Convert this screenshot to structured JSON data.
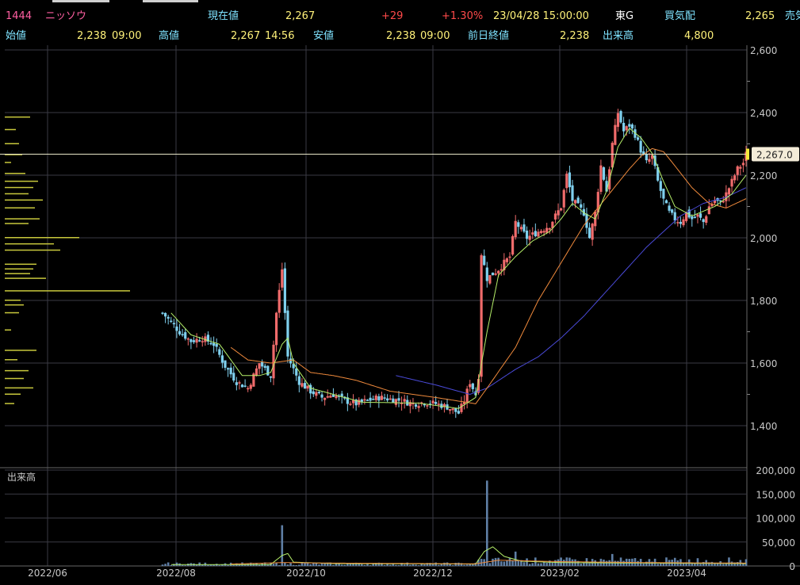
{
  "header": {
    "code": "1444",
    "name": "ニッソウ",
    "current_label": "現在値",
    "current_value": "2,267",
    "change": "+29",
    "change_pct": "+1.30%",
    "datetime": "23/04/28  15:00:00",
    "market": "東G",
    "bid_label": "買気配",
    "bid_value": "2,265",
    "ask_label": "売気"
  },
  "subheader": {
    "open_label": "始値",
    "open_value": "2,238",
    "open_time": "09:00",
    "high_label": "高値",
    "high_value": "2,267",
    "high_time": "14:56",
    "low_label": "安値",
    "low_value": "2,238",
    "low_time": "09:00",
    "prev_label": "前日終値",
    "prev_value": "2,238",
    "volume_label": "出来高",
    "volume_value": "4,800"
  },
  "colors": {
    "up": "#f06b6b",
    "down": "#7fd0ee",
    "ma_short": "#b6f06a",
    "ma_mid": "#f08a3c",
    "ma_long": "#4a4ad8",
    "grid": "#3a3a44",
    "volume": "#5f7fa5",
    "price_profile": "#c8c83c"
  },
  "chart_data": {
    "type": "candlestick",
    "y_axis": {
      "min": 1400,
      "max": 2600,
      "ticks": [
        "2,600",
        "2,400",
        "2,200",
        "2,000",
        "1,800",
        "1,600",
        "1,400"
      ],
      "tick_values": [
        2600,
        2400,
        2200,
        2000,
        1800,
        1600,
        1400
      ]
    },
    "x_axis": {
      "ticks": [
        "2022/06",
        "2022/08",
        "2022/10",
        "2022/12",
        "2023/02",
        "2023/04"
      ]
    },
    "current_price": 2267,
    "current_price_label": "2,267.0",
    "close_anchors": [
      [
        0,
        1760
      ],
      [
        6,
        1700
      ],
      [
        10,
        1670
      ],
      [
        14,
        1680
      ],
      [
        18,
        1660
      ],
      [
        22,
        1590
      ],
      [
        26,
        1540
      ],
      [
        30,
        1520
      ],
      [
        34,
        1600
      ],
      [
        38,
        1560
      ],
      [
        40,
        1760
      ],
      [
        42,
        1900
      ],
      [
        44,
        1620
      ],
      [
        48,
        1540
      ],
      [
        52,
        1510
      ],
      [
        56,
        1490
      ],
      [
        60,
        1500
      ],
      [
        64,
        1480
      ],
      [
        68,
        1470
      ],
      [
        72,
        1480
      ],
      [
        76,
        1490
      ],
      [
        80,
        1485
      ],
      [
        84,
        1480
      ],
      [
        88,
        1470
      ],
      [
        92,
        1475
      ],
      [
        96,
        1470
      ],
      [
        100,
        1460
      ],
      [
        104,
        1440
      ],
      [
        106,
        1480
      ],
      [
        108,
        1540
      ],
      [
        110,
        1500
      ],
      [
        111,
        1560
      ],
      [
        112,
        1950
      ],
      [
        114,
        1870
      ],
      [
        118,
        1900
      ],
      [
        122,
        1940
      ],
      [
        124,
        2050
      ],
      [
        128,
        2000
      ],
      [
        132,
        2020
      ],
      [
        136,
        2040
      ],
      [
        140,
        2100
      ],
      [
        142,
        2200
      ],
      [
        144,
        2120
      ],
      [
        148,
        2080
      ],
      [
        150,
        2000
      ],
      [
        152,
        2080
      ],
      [
        154,
        2230
      ],
      [
        156,
        2150
      ],
      [
        158,
        2300
      ],
      [
        160,
        2400
      ],
      [
        162,
        2340
      ],
      [
        164,
        2360
      ],
      [
        166,
        2330
      ],
      [
        168,
        2280
      ],
      [
        170,
        2240
      ],
      [
        172,
        2260
      ],
      [
        174,
        2180
      ],
      [
        176,
        2120
      ],
      [
        178,
        2080
      ],
      [
        180,
        2060
      ],
      [
        182,
        2050
      ],
      [
        184,
        2080
      ],
      [
        186,
        2060
      ],
      [
        188,
        2070
      ],
      [
        190,
        2050
      ],
      [
        192,
        2100
      ],
      [
        194,
        2120
      ],
      [
        196,
        2110
      ],
      [
        198,
        2140
      ],
      [
        200,
        2180
      ],
      [
        202,
        2220
      ],
      [
        204,
        2240
      ],
      [
        205,
        2267
      ]
    ],
    "ma_short_anchors": [
      [
        3,
        1760
      ],
      [
        10,
        1690
      ],
      [
        20,
        1660
      ],
      [
        28,
        1560
      ],
      [
        34,
        1560
      ],
      [
        38,
        1570
      ],
      [
        42,
        1660
      ],
      [
        44,
        1680
      ],
      [
        46,
        1600
      ],
      [
        52,
        1520
      ],
      [
        60,
        1500
      ],
      [
        70,
        1475
      ],
      [
        90,
        1472
      ],
      [
        104,
        1455
      ],
      [
        110,
        1490
      ],
      [
        114,
        1700
      ],
      [
        118,
        1880
      ],
      [
        124,
        1940
      ],
      [
        130,
        1990
      ],
      [
        136,
        2020
      ],
      [
        140,
        2060
      ],
      [
        144,
        2110
      ],
      [
        148,
        2080
      ],
      [
        152,
        2060
      ],
      [
        156,
        2150
      ],
      [
        160,
        2290
      ],
      [
        164,
        2350
      ],
      [
        168,
        2320
      ],
      [
        172,
        2270
      ],
      [
        176,
        2180
      ],
      [
        180,
        2100
      ],
      [
        186,
        2070
      ],
      [
        194,
        2100
      ],
      [
        200,
        2140
      ],
      [
        205,
        2200
      ]
    ],
    "ma_mid_anchors": [
      [
        24,
        1650
      ],
      [
        30,
        1610
      ],
      [
        38,
        1600
      ],
      [
        46,
        1610
      ],
      [
        52,
        1570
      ],
      [
        60,
        1560
      ],
      [
        68,
        1545
      ],
      [
        80,
        1510
      ],
      [
        96,
        1490
      ],
      [
        110,
        1470
      ],
      [
        114,
        1520
      ],
      [
        124,
        1650
      ],
      [
        132,
        1800
      ],
      [
        140,
        1920
      ],
      [
        148,
        2040
      ],
      [
        156,
        2130
      ],
      [
        164,
        2220
      ],
      [
        168,
        2260
      ],
      [
        172,
        2285
      ],
      [
        176,
        2275
      ],
      [
        180,
        2230
      ],
      [
        186,
        2160
      ],
      [
        192,
        2110
      ],
      [
        198,
        2095
      ],
      [
        205,
        2125
      ]
    ],
    "ma_long_anchors": [
      [
        82,
        1560
      ],
      [
        96,
        1530
      ],
      [
        108,
        1500
      ],
      [
        114,
        1520
      ],
      [
        124,
        1580
      ],
      [
        132,
        1620
      ],
      [
        140,
        1680
      ],
      [
        148,
        1750
      ],
      [
        156,
        1830
      ],
      [
        164,
        1910
      ],
      [
        170,
        1970
      ],
      [
        176,
        2020
      ],
      [
        182,
        2070
      ],
      [
        190,
        2110
      ],
      [
        198,
        2130
      ],
      [
        205,
        2160
      ]
    ],
    "volume": {
      "label": "出来高",
      "ticks": [
        "200,000",
        "150,000",
        "100,000",
        "50,000",
        "0"
      ],
      "tick_values": [
        200000,
        150000,
        100000,
        50000,
        0
      ],
      "spikes": [
        [
          42,
          85000
        ],
        [
          114,
          178000
        ],
        [
          124,
          30000
        ],
        [
          158,
          25000
        ],
        [
          152,
          12000
        ],
        [
          172,
          9000
        ]
      ]
    }
  }
}
